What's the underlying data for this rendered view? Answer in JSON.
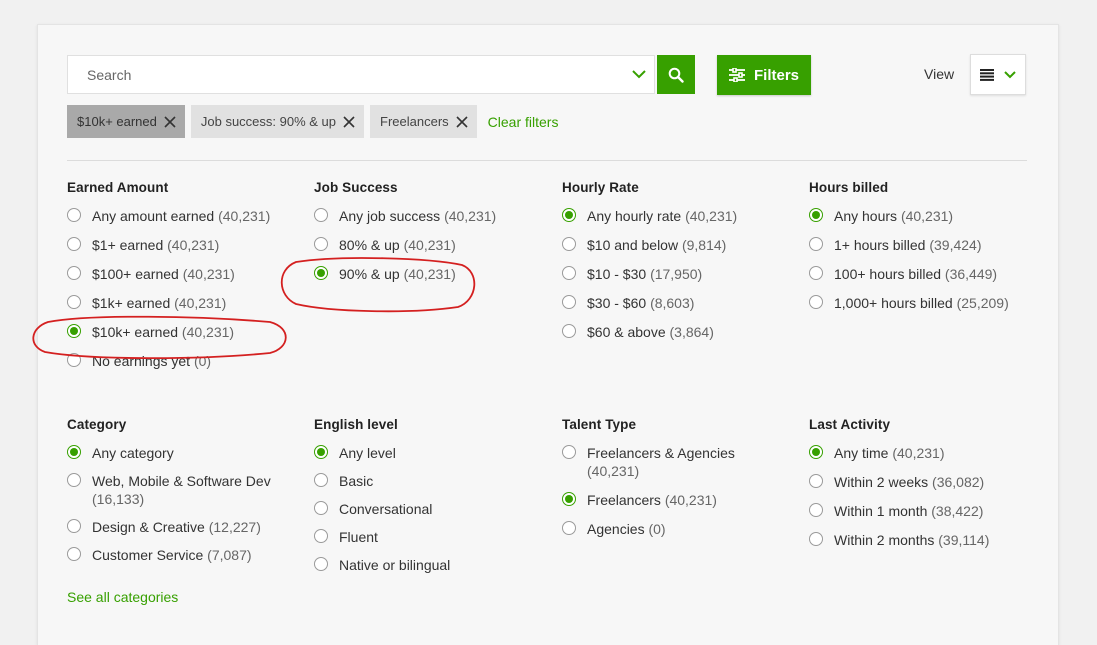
{
  "search": {
    "placeholder": "Search"
  },
  "toolbar": {
    "filters_label": "Filters",
    "view_label": "View"
  },
  "active_filters": [
    {
      "label": "$10k+ earned"
    },
    {
      "label": "Job success: 90% & up"
    },
    {
      "label": "Freelancers"
    }
  ],
  "clear_filters_label": "Clear filters",
  "accent_color": "#37a000",
  "annotation_color": "#d42020",
  "groups": {
    "earned": {
      "title": "Earned Amount",
      "options": [
        {
          "label": "Any amount earned",
          "count": "(40,231)",
          "selected": false
        },
        {
          "label": "$1+ earned",
          "count": "(40,231)",
          "selected": false
        },
        {
          "label": "$100+ earned",
          "count": "(40,231)",
          "selected": false
        },
        {
          "label": "$1k+ earned",
          "count": "(40,231)",
          "selected": false
        },
        {
          "label": "$10k+ earned",
          "count": "(40,231)",
          "selected": true
        },
        {
          "label": "No earnings yet",
          "count": "(0)",
          "selected": false
        }
      ]
    },
    "job_success": {
      "title": "Job Success",
      "options": [
        {
          "label": "Any job success",
          "count": "(40,231)",
          "selected": false
        },
        {
          "label": "80% & up",
          "count": "(40,231)",
          "selected": false
        },
        {
          "label": "90% & up",
          "count": "(40,231)",
          "selected": true
        }
      ]
    },
    "hourly_rate": {
      "title": "Hourly Rate",
      "options": [
        {
          "label": "Any hourly rate",
          "count": "(40,231)",
          "selected": true
        },
        {
          "label": "$10 and below",
          "count": "(9,814)",
          "selected": false
        },
        {
          "label": "$10 - $30",
          "count": "(17,950)",
          "selected": false
        },
        {
          "label": "$30 - $60",
          "count": "(8,603)",
          "selected": false
        },
        {
          "label": "$60 & above",
          "count": "(3,864)",
          "selected": false
        }
      ]
    },
    "hours_billed": {
      "title": "Hours billed",
      "options": [
        {
          "label": "Any hours",
          "count": "(40,231)",
          "selected": true
        },
        {
          "label": "1+ hours billed",
          "count": "(39,424)",
          "selected": false
        },
        {
          "label": "100+ hours billed",
          "count": "(36,449)",
          "selected": false
        },
        {
          "label": "1,000+ hours billed",
          "count": "(25,209)",
          "selected": false
        }
      ]
    },
    "category": {
      "title": "Category",
      "options": [
        {
          "label": "Any category",
          "count": "",
          "selected": true
        },
        {
          "label": "Web, Mobile & Software Dev",
          "count": "(16,133)",
          "selected": false
        },
        {
          "label": "Design & Creative",
          "count": "(12,227)",
          "selected": false
        },
        {
          "label": "Customer Service",
          "count": "(7,087)",
          "selected": false
        }
      ],
      "see_all": "See all categories"
    },
    "english": {
      "title": "English level",
      "options": [
        {
          "label": "Any level",
          "count": "",
          "selected": true
        },
        {
          "label": "Basic",
          "count": "",
          "selected": false
        },
        {
          "label": "Conversational",
          "count": "",
          "selected": false
        },
        {
          "label": "Fluent",
          "count": "",
          "selected": false
        },
        {
          "label": "Native or bilingual",
          "count": "",
          "selected": false
        }
      ]
    },
    "talent_type": {
      "title": "Talent Type",
      "options": [
        {
          "label": "Freelancers & Agencies",
          "count": "(40,231)",
          "selected": false
        },
        {
          "label": "Freelancers",
          "count": "(40,231)",
          "selected": true
        },
        {
          "label": "Agencies",
          "count": "(0)",
          "selected": false
        }
      ]
    },
    "last_activity": {
      "title": "Last Activity",
      "options": [
        {
          "label": "Any time",
          "count": "(40,231)",
          "selected": true
        },
        {
          "label": "Within 2 weeks",
          "count": "(36,082)",
          "selected": false
        },
        {
          "label": "Within 1 month",
          "count": "(38,422)",
          "selected": false
        },
        {
          "label": "Within 2 months",
          "count": "(39,114)",
          "selected": false
        }
      ]
    }
  }
}
